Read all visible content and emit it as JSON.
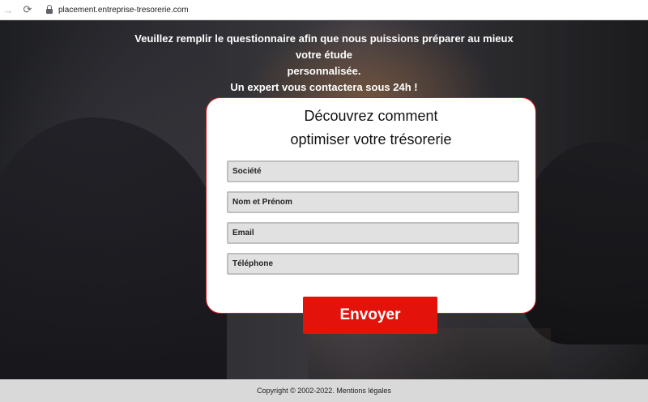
{
  "browser": {
    "url": "placement.entreprise-tresorerie.com"
  },
  "intro": {
    "line1": "Veuillez remplir le questionnaire afin que nous puissions préparer au mieux votre étude",
    "line2": "personnalisée.",
    "line3": "Un expert vous contactera sous 24h !"
  },
  "form": {
    "title_line1": "Découvrez comment",
    "title_line2": "optimiser votre trésorerie",
    "fields": [
      {
        "placeholder": "Société"
      },
      {
        "placeholder": "Nom et Prénom"
      },
      {
        "placeholder": "Email"
      },
      {
        "placeholder": "Téléphone"
      }
    ],
    "submit_label": "Envoyer"
  },
  "footer": {
    "copyright": "Copyright © 2002-2022.",
    "legal_link": "Mentions légales"
  },
  "colors": {
    "accent": "#e3120b",
    "card_border": "#d2161b",
    "field_bg": "#e1e1e1",
    "footer_bg": "#d9d9d9"
  },
  "icons": [
    "back-arrow-icon",
    "reload-icon",
    "lock-icon"
  ]
}
